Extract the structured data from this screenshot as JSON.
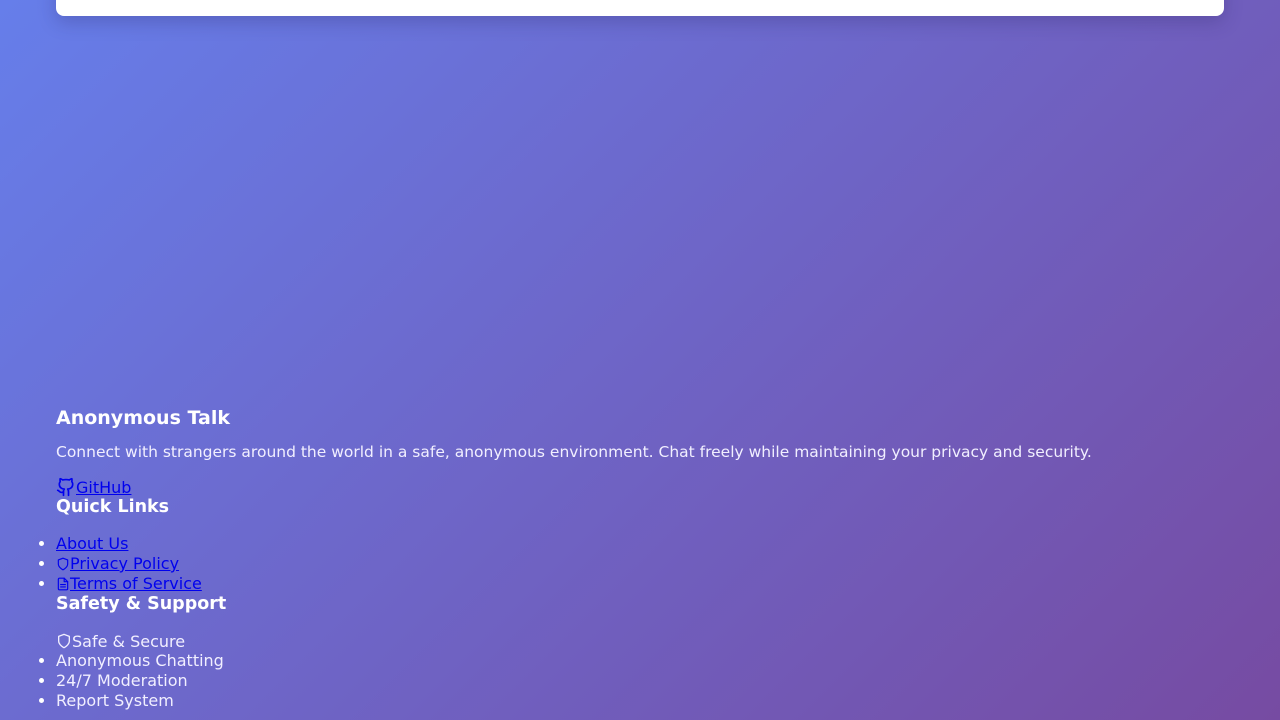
{
  "brand": {
    "title": "Anonymous Talk",
    "description": "Connect with strangers around the world in a safe, anonymous environment. Chat freely while maintaining your privacy and security.",
    "github_label": "GitHub"
  },
  "quick_links": {
    "title": "Quick Links",
    "items": [
      {
        "label": "About Us",
        "icon": "none"
      },
      {
        "label": "Privacy Policy",
        "icon": "shield-icon"
      },
      {
        "label": "Terms of Service",
        "icon": "document-icon"
      }
    ]
  },
  "safety": {
    "title": "Safety & Support",
    "headline": "Safe & Secure",
    "items": [
      {
        "label": "Anonymous Chatting"
      },
      {
        "label": "24/7 Moderation"
      },
      {
        "label": "Report System"
      }
    ]
  },
  "colors": {
    "background_start": "#667eea",
    "background_end": "#764ba2",
    "link": "#0000ee"
  }
}
